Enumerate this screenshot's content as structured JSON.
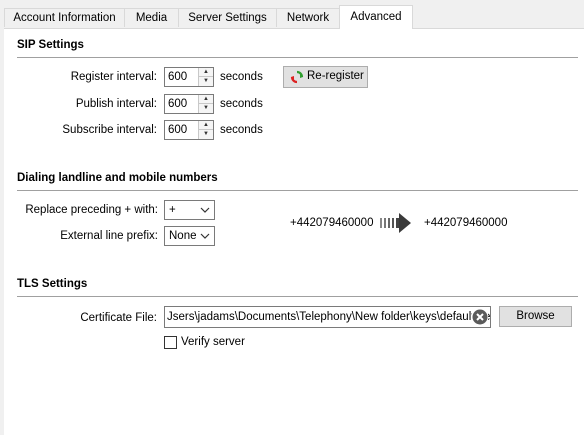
{
  "tabs": [
    {
      "label": "Account Information"
    },
    {
      "label": "Media"
    },
    {
      "label": "Server Settings"
    },
    {
      "label": "Network"
    },
    {
      "label": "Advanced"
    }
  ],
  "sip": {
    "title": "SIP Settings",
    "register_label": "Register interval:",
    "register_value": "600",
    "publish_label": "Publish interval:",
    "publish_value": "600",
    "subscribe_label": "Subscribe interval:",
    "subscribe_value": "600",
    "unit": "seconds",
    "reregister_label": "Re-register"
  },
  "dialing": {
    "title": "Dialing landline and mobile numbers",
    "replace_label": "Replace preceding + with:",
    "replace_value": "+",
    "prefix_label": "External line prefix:",
    "prefix_value": "None",
    "example_input": "+442079460000",
    "example_output": "+442079460000"
  },
  "tls": {
    "title": "TLS Settings",
    "cert_label": "Certificate File:",
    "cert_value": "Jsers\\jadams\\Documents\\Telephony\\New folder\\keys\\default.pem",
    "browse_label": "Browse",
    "verify_label": "Verify server",
    "verify_checked": false
  }
}
